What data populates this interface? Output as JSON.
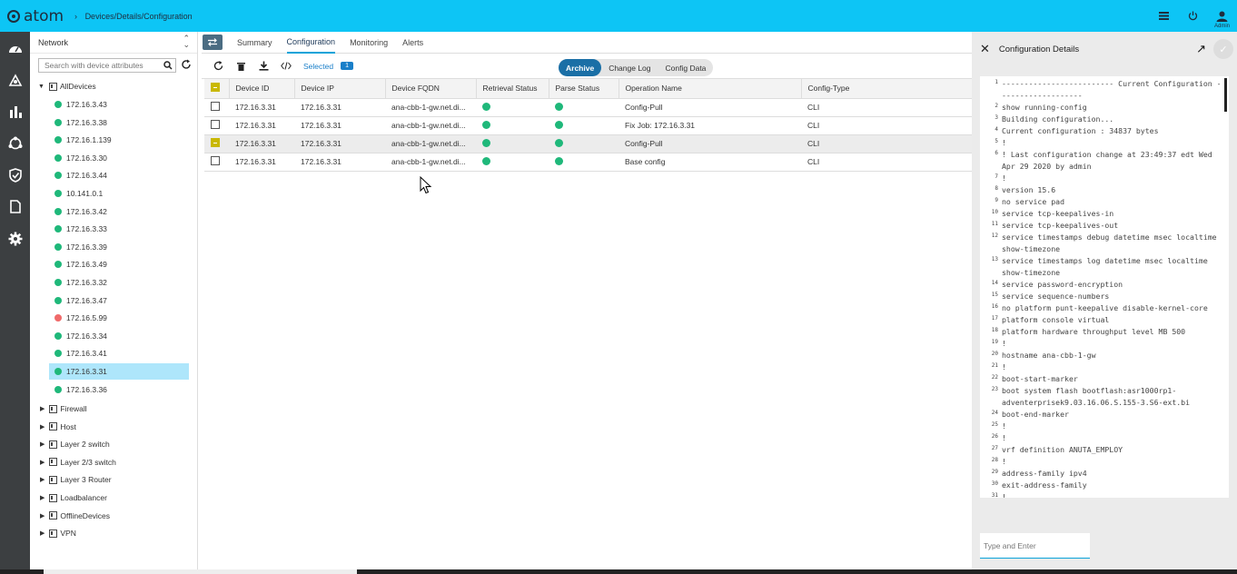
{
  "app": {
    "logo": "atom",
    "breadcrumb": "Devices/Details/Configuration",
    "user": "Admin"
  },
  "tree": {
    "header": "Network",
    "search_placeholder": "Search with device attributes",
    "root": "AllDevices",
    "devices": [
      {
        "ip": "172.16.3.43",
        "status": "up"
      },
      {
        "ip": "172.16.3.38",
        "status": "up"
      },
      {
        "ip": "172.16.1.139",
        "status": "up"
      },
      {
        "ip": "172.16.3.30",
        "status": "up"
      },
      {
        "ip": "172.16.3.44",
        "status": "up"
      },
      {
        "ip": "10.141.0.1",
        "status": "up"
      },
      {
        "ip": "172.16.3.42",
        "status": "up"
      },
      {
        "ip": "172.16.3.33",
        "status": "up"
      },
      {
        "ip": "172.16.3.39",
        "status": "up"
      },
      {
        "ip": "172.16.3.49",
        "status": "up"
      },
      {
        "ip": "172.16.3.32",
        "status": "up"
      },
      {
        "ip": "172.16.3.47",
        "status": "up"
      },
      {
        "ip": "172.16.5.99",
        "status": "down"
      },
      {
        "ip": "172.16.3.34",
        "status": "up"
      },
      {
        "ip": "172.16.3.41",
        "status": "up"
      },
      {
        "ip": "172.16.3.31",
        "status": "up",
        "selected": true
      },
      {
        "ip": "172.16.3.36",
        "status": "up"
      }
    ],
    "groups": [
      "Firewall",
      "Host",
      "Layer 2 switch",
      "Layer 2/3 switch",
      "Layer 3 Router",
      "Loadbalancer",
      "OfflineDevices",
      "VPN"
    ]
  },
  "tabs": [
    "Summary",
    "Configuration",
    "Monitoring",
    "Alerts"
  ],
  "active_tab": "Configuration",
  "toolbar": {
    "selected_label": "Selected",
    "selected_count": "1",
    "segments": [
      "Archive",
      "Change Log",
      "Config Data"
    ],
    "active_segment": "Archive"
  },
  "table": {
    "columns": [
      "Device ID",
      "Device IP",
      "Device FQDN",
      "Retrieval Status",
      "Parse Status",
      "Operation Name",
      "Config-Type"
    ],
    "rows": [
      {
        "device_id": "172.16.3.31",
        "device_ip": "172.16.3.31",
        "fqdn": "ana-cbb-1-gw.net.di...",
        "operation": "Config-Pull",
        "type": "CLI"
      },
      {
        "device_id": "172.16.3.31",
        "device_ip": "172.16.3.31",
        "fqdn": "ana-cbb-1-gw.net.di...",
        "operation": "Fix Job: 172.16.3.31",
        "type": "CLI"
      },
      {
        "device_id": "172.16.3.31",
        "device_ip": "172.16.3.31",
        "fqdn": "ana-cbb-1-gw.net.di...",
        "operation": "Config-Pull",
        "type": "CLI",
        "highlighted": true
      },
      {
        "device_id": "172.16.3.31",
        "device_ip": "172.16.3.31",
        "fqdn": "ana-cbb-1-gw.net.di...",
        "operation": "Base config",
        "type": "CLI"
      }
    ]
  },
  "panel": {
    "title": "Configuration Details",
    "input_placeholder": "Type and Enter",
    "lines": [
      {
        "n": "1",
        "rows": [
          "------------------------- Current Configuration -",
          "------------------"
        ]
      },
      {
        "n": "2",
        "rows": [
          "show running-config"
        ]
      },
      {
        "n": "3",
        "rows": [
          "Building configuration..."
        ]
      },
      {
        "n": "4",
        "rows": [
          "Current configuration : 34837 bytes"
        ]
      },
      {
        "n": "5",
        "rows": [
          "!"
        ]
      },
      {
        "n": "6",
        "rows": [
          "! Last configuration change at 23:49:37 edt Wed",
          "Apr 29 2020 by admin"
        ]
      },
      {
        "n": "7",
        "rows": [
          "!"
        ]
      },
      {
        "n": "8",
        "rows": [
          "version 15.6"
        ]
      },
      {
        "n": "9",
        "rows": [
          "no service pad"
        ]
      },
      {
        "n": "10",
        "rows": [
          "service tcp-keepalives-in"
        ]
      },
      {
        "n": "11",
        "rows": [
          "service tcp-keepalives-out"
        ]
      },
      {
        "n": "12",
        "rows": [
          "service timestamps debug datetime msec localtime",
          "show-timezone"
        ]
      },
      {
        "n": "13",
        "rows": [
          "service timestamps log datetime msec localtime",
          "show-timezone"
        ]
      },
      {
        "n": "14",
        "rows": [
          "service password-encryption"
        ]
      },
      {
        "n": "15",
        "rows": [
          "service sequence-numbers"
        ]
      },
      {
        "n": "16",
        "rows": [
          "no platform punt-keepalive disable-kernel-core"
        ]
      },
      {
        "n": "17",
        "rows": [
          "platform console virtual"
        ]
      },
      {
        "n": "18",
        "rows": [
          "platform hardware throughput level MB 500"
        ]
      },
      {
        "n": "19",
        "rows": [
          "!"
        ]
      },
      {
        "n": "20",
        "rows": [
          "hostname ana-cbb-1-gw"
        ]
      },
      {
        "n": "21",
        "rows": [
          "!"
        ]
      },
      {
        "n": "22",
        "rows": [
          "boot-start-marker"
        ]
      },
      {
        "n": "23",
        "rows": [
          "boot system flash bootflash:asr1000rp1-",
          "adventerprisek9.03.16.06.S.155-3.S6-ext.bi"
        ]
      },
      {
        "n": "24",
        "rows": [
          "boot-end-marker"
        ]
      },
      {
        "n": "25",
        "rows": [
          "!"
        ]
      },
      {
        "n": "26",
        "rows": [
          "!"
        ]
      },
      {
        "n": "27",
        "rows": [
          "vrf definition ANUTA_EMPLOY"
        ]
      },
      {
        "n": "28",
        "rows": [
          "!"
        ]
      },
      {
        "n": "29",
        "rows": [
          "address-family ipv4"
        ]
      },
      {
        "n": "30",
        "rows": [
          "exit-address-family"
        ]
      },
      {
        "n": "31",
        "rows": [
          "!"
        ]
      }
    ]
  },
  "colors": {
    "topbar": "#0dc5f5",
    "nav": "#3c3f41",
    "status_up": "#1fb87a",
    "status_down": "#f06a6a",
    "accent": "#1a7fc9"
  }
}
